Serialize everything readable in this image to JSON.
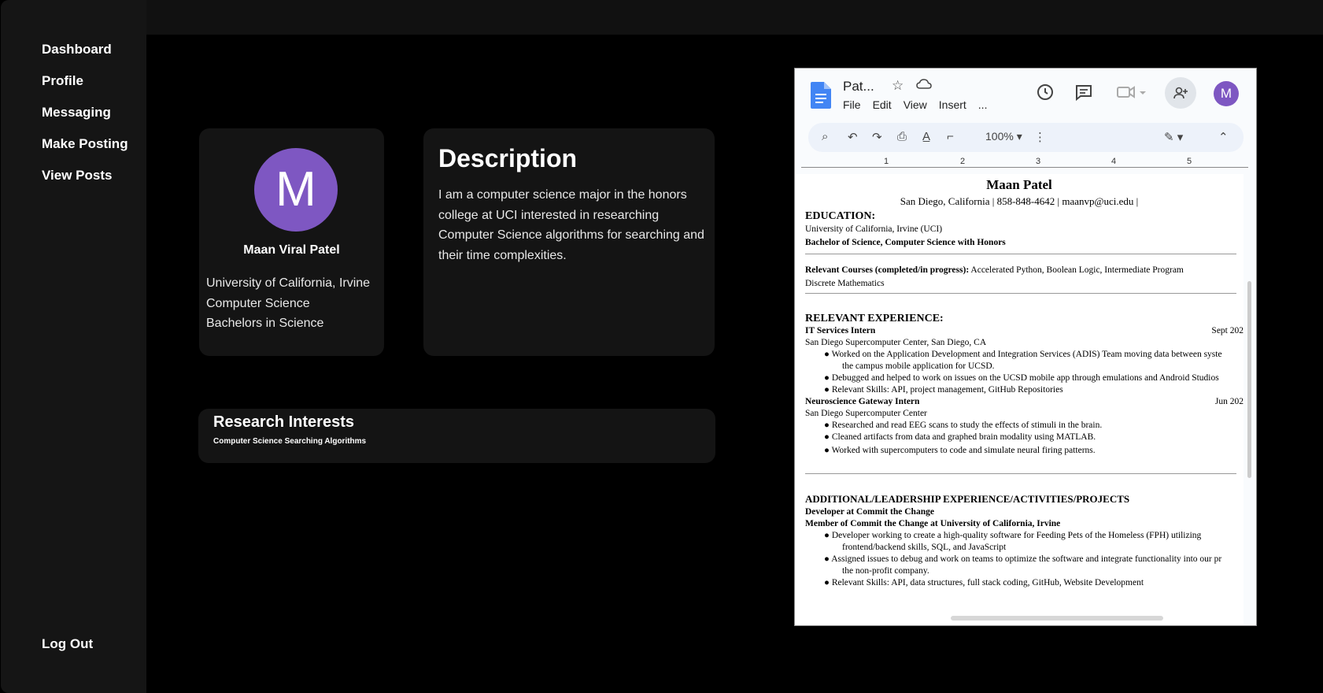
{
  "sidebar": {
    "items": [
      {
        "label": "Dashboard"
      },
      {
        "label": "Profile"
      },
      {
        "label": "Messaging"
      },
      {
        "label": "Make Posting"
      },
      {
        "label": "View Posts"
      }
    ],
    "logout": "Log Out"
  },
  "profile": {
    "initial": "M",
    "name": "Maan Viral Patel",
    "university": "University of California, Irvine",
    "major": "Computer Science",
    "degree": "Bachelors in Science",
    "avatar_color": "#7e57c2"
  },
  "description": {
    "title": "Description",
    "text": "I am a computer science major in the honors college at UCI interested in researching Computer Science algorithms for searching and their time complexities."
  },
  "research": {
    "title": "Research Interests",
    "text": "Computer Science Searching Algorithms"
  },
  "gdoc": {
    "title": "Pat...",
    "menu": [
      "File",
      "Edit",
      "View",
      "Insert",
      "..."
    ],
    "avatar_initial": "M",
    "zoom": "100%",
    "ruler_numbers": [
      "1",
      "2",
      "3",
      "4",
      "5"
    ],
    "resume": {
      "name": "Maan Patel",
      "contact": "San Diego, California | 858-848-4642 | maanvp@uci.edu |",
      "education_heading": "EDUCATION:",
      "school": "University of California, Irvine (UCI)",
      "degree": "Bachelor of Science, Computer Science with Honors",
      "courses_label": "Relevant Courses (completed/in progress):",
      "courses_text": "Accelerated Python, Boolean Logic, Intermediate Program",
      "courses_text2": "Discrete Mathematics",
      "experience_heading": "RELEVANT EXPERIENCE:",
      "job1_title": "IT Services Intern",
      "job1_date": "Sept 202",
      "job1_org": "San Diego Supercomputer Center, San Diego, CA",
      "job1_b1": "Worked on the Application Development and Integration Services (ADIS) Team moving data between syste",
      "job1_b1b": "the campus mobile application for UCSD.",
      "job1_b2": "Debugged and helped to work on issues on the UCSD mobile app through emulations and  Android Studios",
      "job1_b3": "Relevant Skills: API, project management, GitHub Repositories",
      "job2_title": "Neuroscience Gateway Intern",
      "job2_date": "Jun 202",
      "job2_org": "San Diego Supercomputer Center",
      "job2_b1": "Researched and read EEG scans to study the effects of stimuli in the brain.",
      "job2_b2": "Cleaned artifacts from data and graphed brain modality using MATLAB.",
      "job2_b3": "Worked with supercomputers to code and simulate neural firing patterns.",
      "additional_heading": "ADDITIONAL/LEADERSHIP EXPERIENCE/ACTIVITIES/PROJECTS",
      "add1": "Developer at Commit the Change",
      "add2": "Member of Commit the Change at University of California, Irvine",
      "add_b1": "Developer working to create a high-quality software for Feeding Pets of the Homeless (FPH)  utilizing",
      "add_b1b": "frontend/backend skills, SQL, and JavaScript",
      "add_b2": "Assigned issues to debug and work on teams to optimize the software and integrate functionality  into our pr",
      "add_b2b": "the non-profit company.",
      "add_b3": "Relevant Skills: API, data structures, full stack coding, GitHub, Website Development"
    }
  }
}
